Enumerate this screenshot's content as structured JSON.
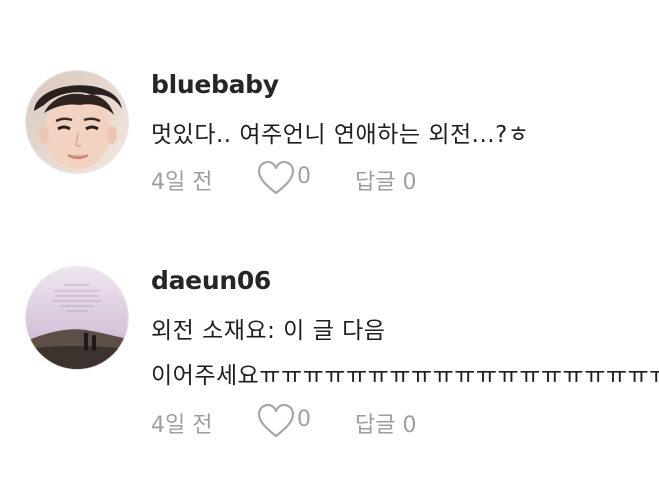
{
  "comments": [
    {
      "username": "bluebaby",
      "text_lines": [
        "멋있다..  여주언니 연애하는 외전...?ㅎ"
      ],
      "time": "4일 전",
      "likes": "0",
      "reply_label": "답글 0"
    },
    {
      "username": "daeun06",
      "text_lines": [
        "외전 소재요: 이 글 다음",
        "이어주세요ㅠㅠㅠㅠㅠㅠㅠㅠㅠㅠㅠㅠㅠㅠㅠㅠㅠㅠㅠ"
      ],
      "time": "4일 전",
      "likes": "0",
      "reply_label": "답글 0"
    }
  ],
  "colors": {
    "username": "#262626",
    "text": "#1f1f1f",
    "meta": "#9e9e9e",
    "heart_stroke": "#a8a8a8"
  },
  "icons": [
    "avatar-photo",
    "heart-icon"
  ]
}
